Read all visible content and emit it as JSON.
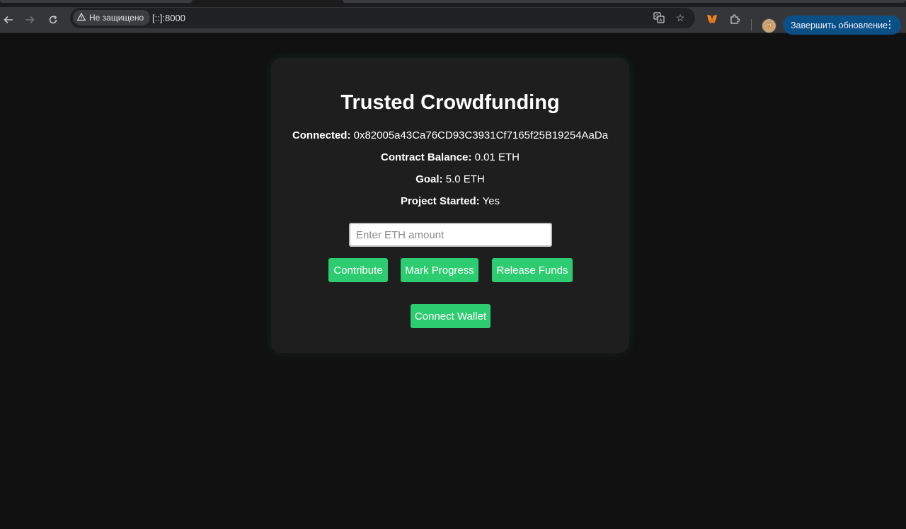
{
  "browser": {
    "security_label": "Не защищено",
    "url": "[::]:8000",
    "update_button_label": "Завершить обновление",
    "icons": [
      "back-icon",
      "forward-icon",
      "reload-icon",
      "warning-icon",
      "translate-icon",
      "star-icon",
      "metamask-icon",
      "puzzle-icon",
      "profile-avatar",
      "more-vert-icon"
    ]
  },
  "app": {
    "title": "Trusted Crowdfunding",
    "info": [
      {
        "label": "Connected:",
        "value": "0x82005a43Ca76CD93C3931Cf7165f25B19254AaDa"
      },
      {
        "label": "Contract Balance:",
        "value": "0.01 ETH"
      },
      {
        "label": "Goal:",
        "value": "5.0 ETH"
      },
      {
        "label": "Project Started:",
        "value": "Yes"
      }
    ],
    "amount_input": {
      "placeholder": "Enter ETH amount",
      "value": ""
    },
    "buttons": {
      "contribute": "Contribute",
      "mark_progress": "Mark Progress",
      "release_funds": "Release Funds",
      "connect_wallet": "Connect Wallet"
    },
    "colors": {
      "page_bg": "#111111",
      "card_bg": "#1e1e1e",
      "button": "#2ecc71"
    }
  }
}
